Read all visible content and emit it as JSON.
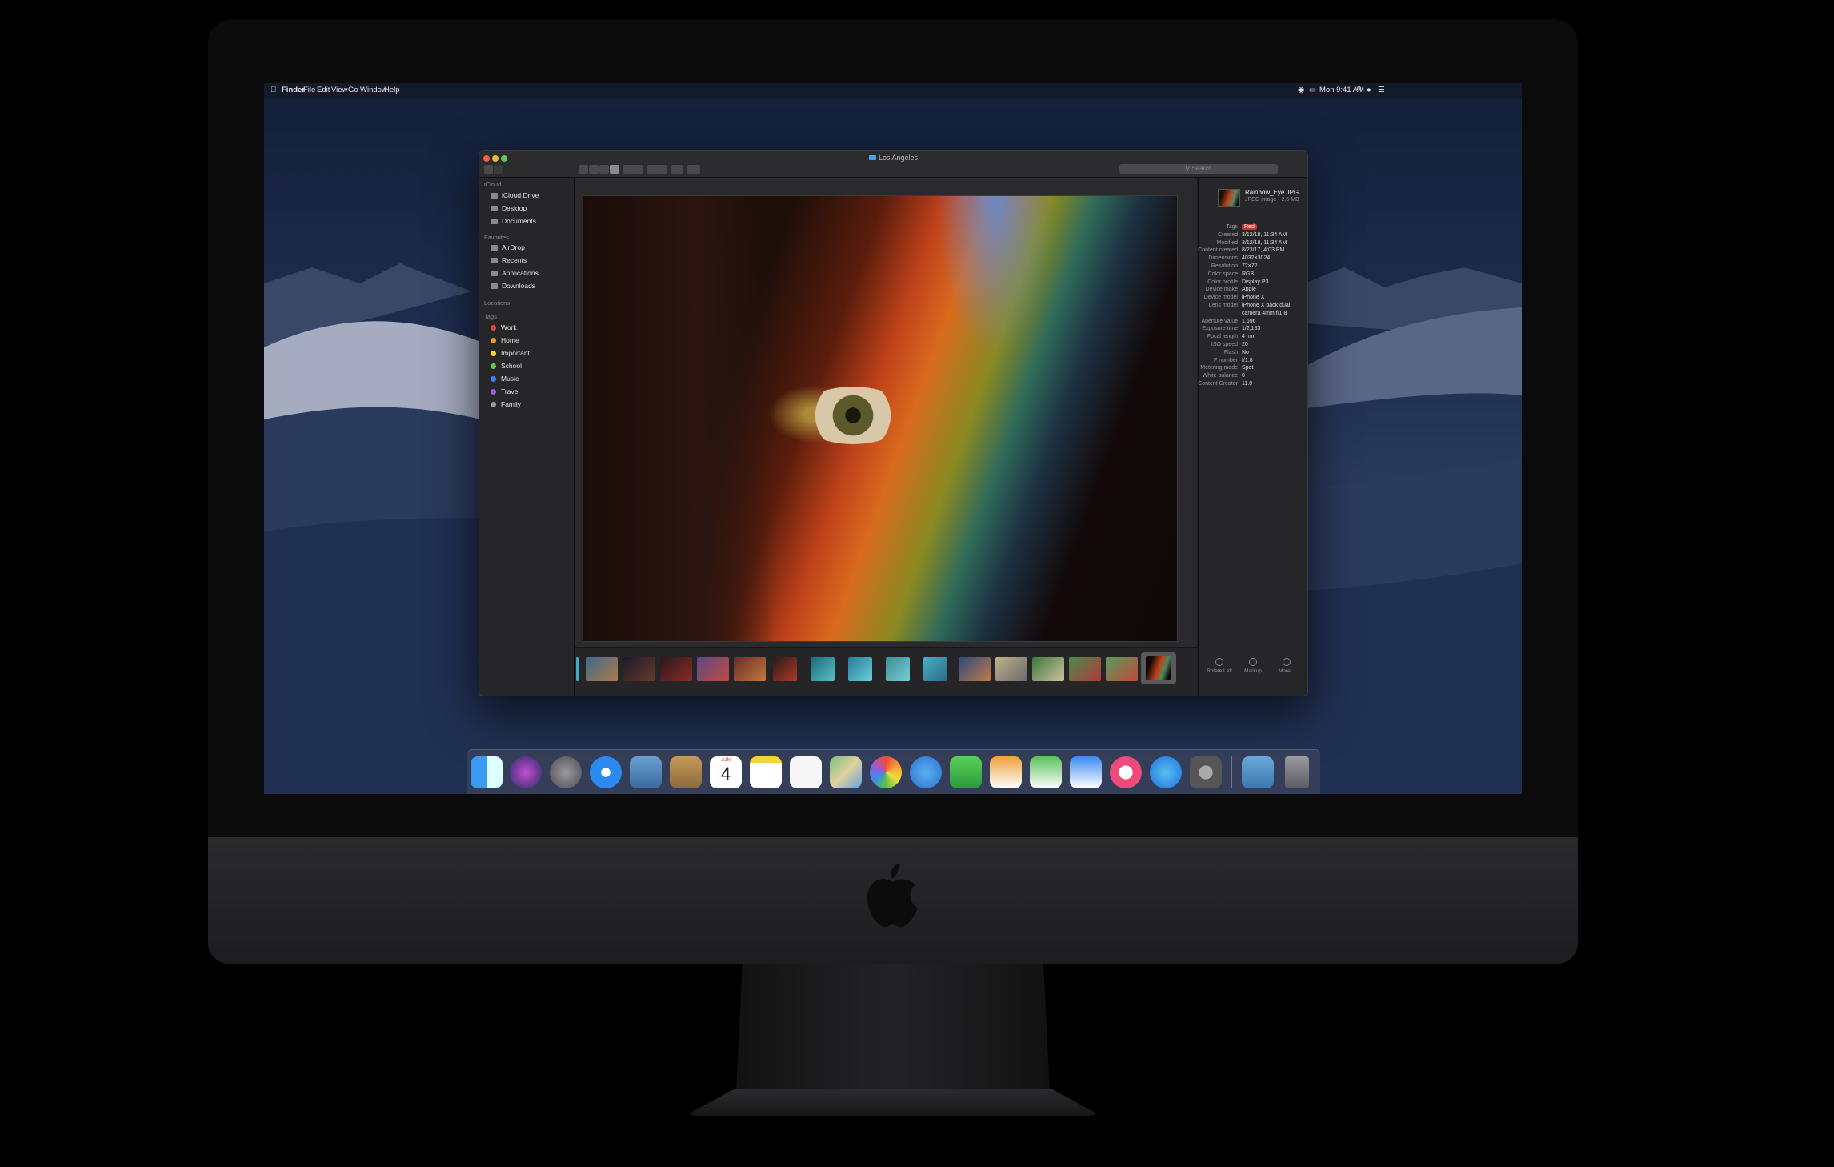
{
  "menubar": {
    "apple": "",
    "items": [
      "Finder",
      "File",
      "Edit",
      "View",
      "Go",
      "Window",
      "Help"
    ],
    "clock": "Mon 9:41 AM"
  },
  "window": {
    "title": "Los Angeles",
    "search_placeholder": "Search"
  },
  "sidebar": {
    "icloud_header": "iCloud",
    "icloud": [
      "iCloud Drive",
      "Desktop",
      "Documents"
    ],
    "favorites_header": "Favorites",
    "favorites": [
      "AirDrop",
      "Recents",
      "Applications",
      "Downloads"
    ],
    "locations_header": "Locations",
    "tags_header": "Tags",
    "tags": [
      {
        "label": "Work",
        "color": "#e0443a"
      },
      {
        "label": "Home",
        "color": "#f0962a"
      },
      {
        "label": "Important",
        "color": "#f2d33a"
      },
      {
        "label": "School",
        "color": "#5fc94a"
      },
      {
        "label": "Music",
        "color": "#3d82f0"
      },
      {
        "label": "Travel",
        "color": "#9a5ad6"
      },
      {
        "label": "Family",
        "color": "#9a9a9e"
      }
    ]
  },
  "inspector": {
    "file_name": "Rainbow_Eye.JPG",
    "file_kind": "JPEG image - 2.6 MB",
    "metadata": [
      {
        "k": "Tags",
        "v": "Red"
      },
      {
        "k": "Created",
        "v": "3/12/18, 11:34 AM"
      },
      {
        "k": "Modified",
        "v": "3/12/18, 11:34 AM"
      },
      {
        "k": "Content created",
        "v": "8/23/17, 4:03 PM"
      },
      {
        "k": "Dimensions",
        "v": "4032×3024"
      },
      {
        "k": "Resolution",
        "v": "72×72"
      },
      {
        "k": "Color space",
        "v": "RGB"
      },
      {
        "k": "Color profile",
        "v": "Display P3"
      },
      {
        "k": "Device make",
        "v": "Apple"
      },
      {
        "k": "Device model",
        "v": "iPhone X"
      },
      {
        "k": "Lens model",
        "v": "iPhone X back dual"
      },
      {
        "k": "",
        "v": "camera 4mm f/1.8"
      },
      {
        "k": "Aperture value",
        "v": "1.696"
      },
      {
        "k": "Exposure time",
        "v": "1/2,183"
      },
      {
        "k": "Focal length",
        "v": "4 mm"
      },
      {
        "k": "ISO speed",
        "v": "20"
      },
      {
        "k": "Flash",
        "v": "No"
      },
      {
        "k": "F number",
        "v": "f/1.8"
      },
      {
        "k": "Metering mode",
        "v": "Spot"
      },
      {
        "k": "White balance",
        "v": "0"
      },
      {
        "k": "Content Creator",
        "v": "11.0"
      }
    ],
    "actions": [
      "Rotate Left",
      "Markup",
      "More..."
    ]
  },
  "dock": {
    "calendar_month": "JUN",
    "calendar_day": "4",
    "apps": [
      "finder-icon",
      "siri-icon",
      "launchpad-icon",
      "safari-icon",
      "mail-icon",
      "contacts-icon",
      "calendar-icon",
      "notes-icon",
      "reminders-icon",
      "maps-icon",
      "photos-icon",
      "messages-icon",
      "facetime-icon",
      "pages-icon",
      "numbers-icon",
      "keynote-icon",
      "itunes-icon",
      "appstore-icon",
      "system-preferences-icon"
    ]
  }
}
